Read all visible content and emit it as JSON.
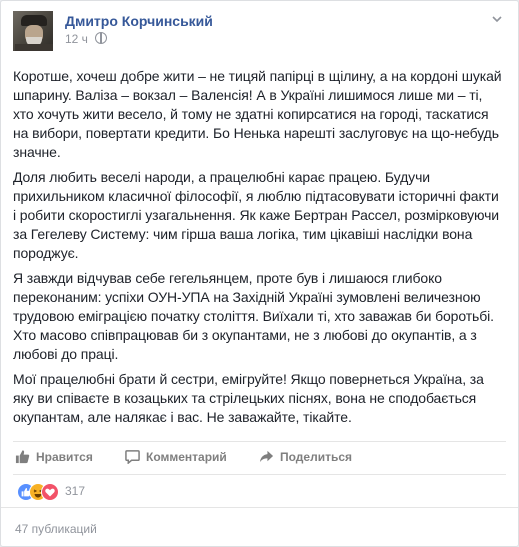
{
  "post": {
    "author": "Дмитро Корчинський",
    "timestamp": "12 ч",
    "privacy_icon": "globe-icon",
    "paragraphs": [
      "Коротше, хочеш добре жити – не тицяй папірці в щілину, а на кордоні шукай шпарину. Валіза – вокзал – Валенсія! А в Україні лишимося лише ми – ті, хто хочуть жити весело, й тому не здатні копирсатися на городі, таскатися на вибори, повертати кредити. Бо Ненька нарешті заслуговує на що-небудь значне.",
      "Доля любить веселі народи, а працелюбні карає працею. Будучи прихильником класичної філософії, я люблю підтасовувати історичні факти і робити скоростиглі узагальнення. Як каже Бертран Рассел, розмірковуючи за Гегелеву Систему: чим гірша ваша логіка, тим цікавіші наслідки вона породжує.",
      "Я завжди відчував себе гегельянцем, проте був і лишаюся глибоко переконаним: успіхи ОУН-УПА на Західній Україні зумовлені величезною трудовою еміграцією початку століття. Виїхали ті, хто заважав би боротьбі. Хто масово співпрацював би з окупантами, не з любові до окупантів, а з любові до праці.",
      "Мої працелюбні брати й сестри, емігруйте! Якщо повернеться Україна, за яку ви співаєте в козацьких та стрілецьких піснях, вона не сподобається окупантам, але налякає і вас. Не заважайте, тікайте."
    ]
  },
  "actions": {
    "like_label": "Нравится",
    "comment_label": "Комментарий",
    "share_label": "Поделиться"
  },
  "reactions": {
    "types": [
      "like",
      "haha",
      "love"
    ],
    "count": "317"
  },
  "footer": {
    "shares_label": "47 публикаций"
  },
  "colors": {
    "author_link": "#365899",
    "meta_text": "#90949c",
    "like_blue": "#5890ff",
    "love_red": "#f25268",
    "haha_yellow": "#f7b125"
  }
}
